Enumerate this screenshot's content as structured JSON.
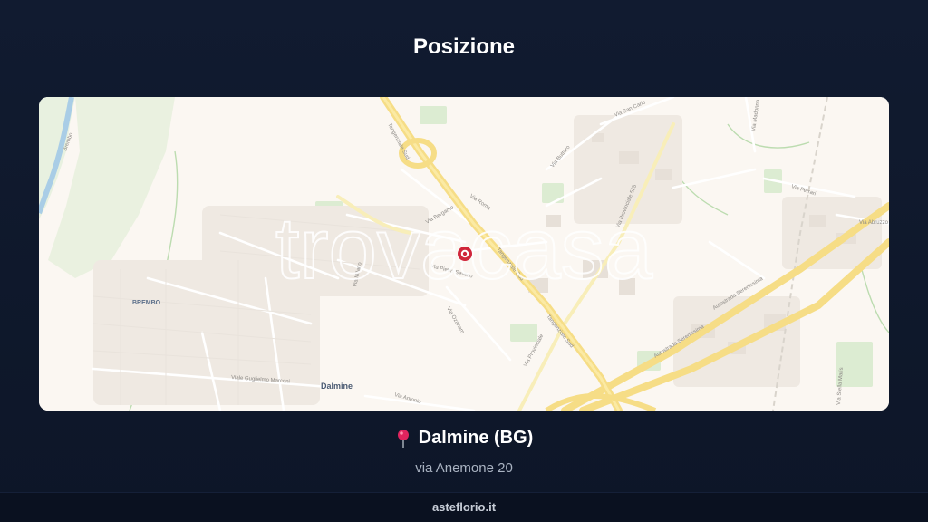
{
  "section_title": "Posizione",
  "map": {
    "watermark": "trovacasa",
    "place_labels": {
      "town": "Dalmine",
      "district": "BREMBO"
    },
    "street_labels": {
      "tangenziale_sud_a": "Tangenziale Sud",
      "tangenziale_sud_b": "Tangenziale Sud",
      "tangenziale_sud_c": "Tangenziale Sud",
      "autostrada_a": "Autostrada Serenissima",
      "autostrada_b": "Autostrada Serenissima",
      "via_provinciale_525": "Via Provinciale 525",
      "via_provinciale": "Via Provinciale",
      "via_guglielmo_marconi": "Viale Guglielmo Marconi",
      "via_bergamo": "Via Bergamo",
      "via_san_carlo": "Via San Carlo",
      "via_buttaro": "Via Buttaro",
      "via_ozanam": "Via Ozanam",
      "via_pietro_seveso": "Via Pietro Seveso",
      "via_roma": "Via Roma",
      "via_antonio": "Via Antonio",
      "via_abruzzo": "Via Abruzzo",
      "via_madonna": "Via Madonna",
      "via_milano": "Via Milano",
      "via_ferrari": "Via Ferrari",
      "via_stella_maris": "Via Stella Maris",
      "via_brembo": "Brembo"
    },
    "marker_color": "#d0263b"
  },
  "location": {
    "pin_icon": "round-pushpin-icon",
    "city": "Dalmine (BG)",
    "address": "via Anemone 20"
  },
  "footer": {
    "site": "asteflorio.it"
  }
}
